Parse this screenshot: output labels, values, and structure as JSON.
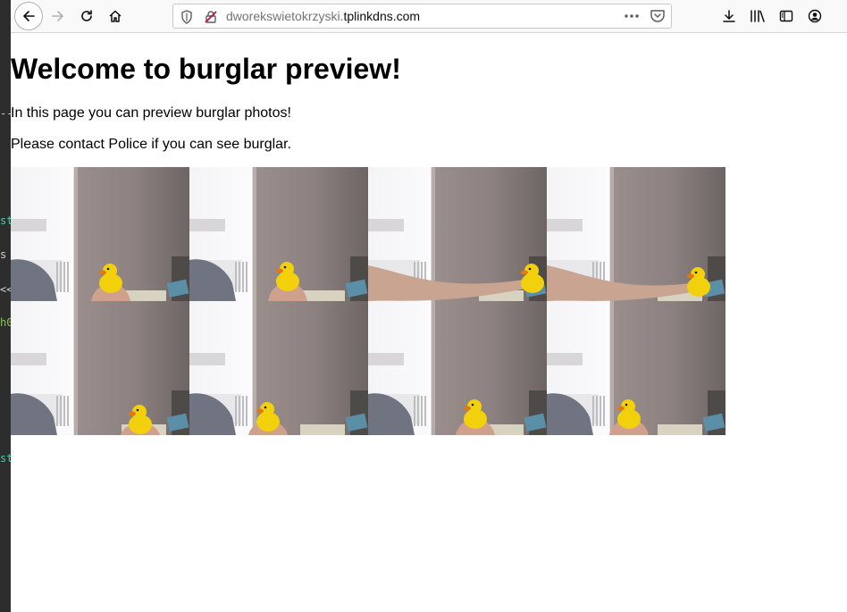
{
  "browser": {
    "url_subdomain": "dworekswietokrzyski.",
    "url_domain": "tplinkdns.com"
  },
  "page": {
    "heading": "Welcome to burglar preview!",
    "paragraph1": "In this page you can preview burglar photos!",
    "paragraph2": "Please contact Police if you can see burglar."
  },
  "photos": {
    "count": 8,
    "columns": 4,
    "rows": 2,
    "subject": "rubber duck held by hand"
  },
  "terminal_strip": {
    "fragments": [
      "--",
      "st",
      "s",
      "<<",
      "h0",
      "st"
    ]
  },
  "colors": {
    "toolbar_bg": "#f9f9fa",
    "terminal_bg": "#2d2d2d",
    "duck_yellow": "#f2d10c"
  }
}
